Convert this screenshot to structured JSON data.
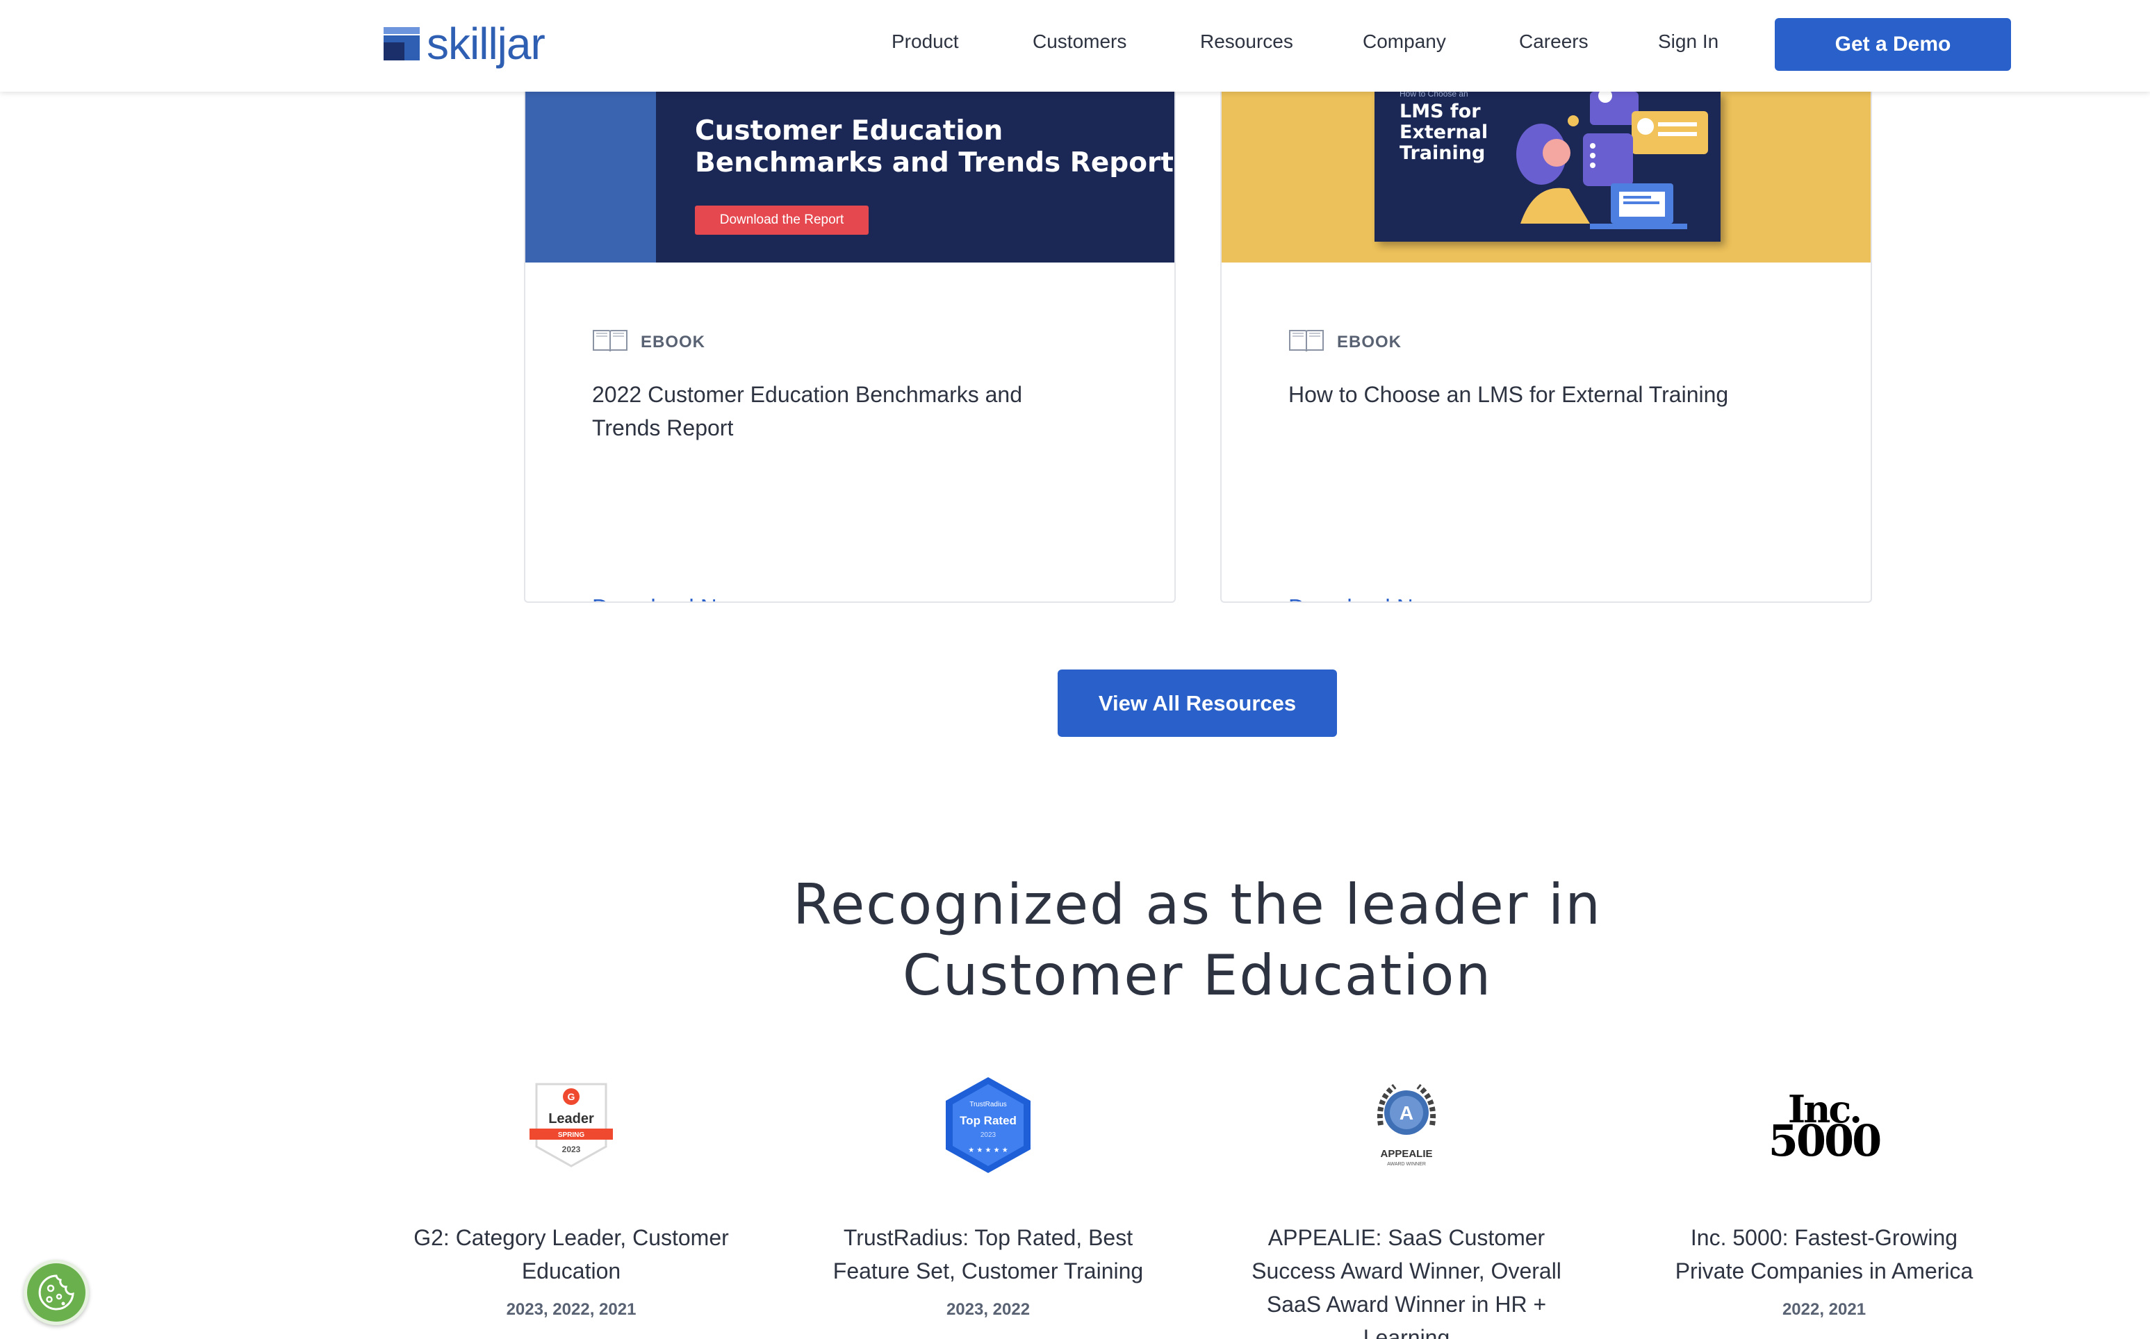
{
  "header": {
    "logo_text": "skilljar",
    "nav": [
      "Product",
      "Customers",
      "Resources",
      "Company",
      "Careers",
      "Sign In"
    ],
    "cta": "Get a Demo"
  },
  "cards": [
    {
      "banner_title_line1": "Customer Education",
      "banner_title_line2": "Benchmarks and Trends Report",
      "banner_button": "Download the Report",
      "type": "EBOOK",
      "title": "2022 Customer Education Benchmarks and Trends Report",
      "link": "Download Now",
      "icon": "book-icon"
    },
    {
      "banner_small": "How to Choose an",
      "banner_title_line1": "LMS for",
      "banner_title_line2": "External",
      "banner_title_line3": "Training",
      "type": "EBOOK",
      "title": "How to Choose an LMS for External Training",
      "link": "Download Now",
      "icon": "book-icon"
    }
  ],
  "view_all": "View All Resources",
  "section": {
    "title_line1": "Recognized as the leader in",
    "title_line2": "Customer Education"
  },
  "awards": [
    {
      "badge_top": "G",
      "badge_text": "Leader",
      "badge_season": "SPRING",
      "badge_year": "2023",
      "name": "G2: Category Leader, Customer Education",
      "years": "2023, 2022, 2021"
    },
    {
      "badge_top": "TrustRadius",
      "badge_text": "Top Rated",
      "badge_year": "2023",
      "name": "TrustRadius: Top Rated, Best Feature Set, Customer Training",
      "years": "2023, 2022"
    },
    {
      "badge_text": "APPEALIE",
      "badge_sub": "AWARD WINNER",
      "name": "APPEALIE: SaaS Customer Success Award Winner, Overall SaaS Award Winner in HR + Learning",
      "years": ""
    },
    {
      "badge_line1": "Inc.",
      "badge_line2": "5000",
      "name": "Inc. 5000: Fastest-Growing Private Companies in America",
      "years": "2022, 2021"
    }
  ],
  "colors": {
    "primary": "#2960c9",
    "navy": "#1b2754",
    "yellow": "#ecc05a",
    "cookie": "#6ab04c"
  }
}
